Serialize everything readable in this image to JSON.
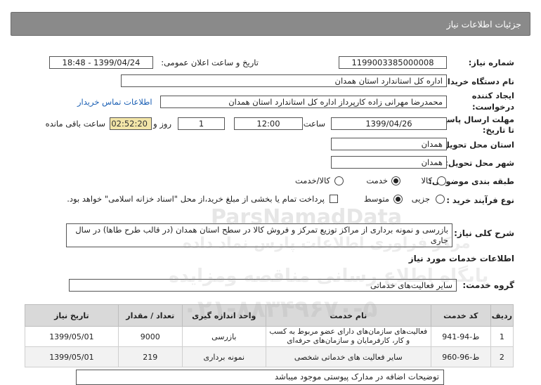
{
  "header": {
    "title": "جزئیات اطلاعات نیاز"
  },
  "labels": {
    "need_number": "شماره نیاز:",
    "announce_datetime": "تاریخ و ساعت اعلان عمومی:",
    "buyer_org": "نام دستگاه خریدار:",
    "creator_line1": "ایجاد کننده",
    "creator_line2": "درخواست:",
    "deadline_line1": "مهلت ارسال پاسخ:",
    "deadline_line2": "تا تاریخ:",
    "time": "ساعت",
    "day_and": "روز و",
    "remaining": "ساعت باقی مانده",
    "province": "استان محل تحویل:",
    "city": "شهر محل تحویل:",
    "category": "طبقه بندی موضوعی:",
    "process_type": "نوع فرآیند خرید :",
    "need_desc": "شرح کلی نیاز:",
    "services_info": "اطلاعات خدمات مورد نیاز",
    "service_group": "گروه خدمت:"
  },
  "values": {
    "need_number": "1199003385000008",
    "announce_datetime": "1399/04/24 - 18:48",
    "buyer_org": "اداره کل استاندارد استان همدان",
    "creator": "محمدرضا مهرانی زاده کارپرداز اداره کل استاندارد استان همدان",
    "contact_link": "اطلاعات تماس خریدار",
    "deadline_date": "1399/04/26",
    "deadline_time": "12:00",
    "days": "1",
    "remaining_time": "02:52:20",
    "province": "همدان",
    "city": "همدان",
    "need_desc": "بازرسی و نمونه برداری از مراکز توزیع  تمرکز و فروش کالا در سطح استان همدان (در قالب طرح طاها) در سال جاری",
    "service_group": "سایر فعالیت‌های خدماتی",
    "extra_note": "توضیحات اضافه در مدارک پیوستی موجود میباشد"
  },
  "category_options": {
    "goods": "کالا",
    "service": "خدمت",
    "goods_service": "کالا/خدمت",
    "selected": "service"
  },
  "process_options": {
    "partial": "جزیی",
    "medium": "متوسط",
    "selected": "medium",
    "treasury_note": "پرداخت تمام یا بخشی از مبلغ خرید،از محل \"اسناد خزانه اسلامی\" خواهد بود."
  },
  "table": {
    "headers": [
      "ردیف",
      "کد خدمت",
      "نام خدمت",
      "واحد اندازه گیری",
      "تعداد / مقدار",
      "تاریخ نیاز"
    ],
    "rows": [
      [
        "1",
        "ط-94-941",
        "فعالیت‌های سازمان‌های دارای عضو مربوط به کسب و کار، کارفرمایان و سازمان‌های حرفه‌ای",
        "بازرسی",
        "9000",
        "1399/05/01"
      ],
      [
        "2",
        "ط-96-960",
        "سایر فعالیت های خدماتی شخصی",
        "نمونه برداری",
        "219",
        "1399/05/01"
      ]
    ]
  },
  "watermark": {
    "brand": "ParsNamadData",
    "line1": "مرکز فراوری اطلاعات پارس نماد داده",
    "line2": "پایگاه اطلاع رسانی مناقصه ومزایده",
    "phone": "۰۲۱-۸۸۳۴۹۶۷۰-۵"
  },
  "colors": {
    "header_bg": "#8a8a8a",
    "remaining_bg": "#f3e6a8",
    "link": "#1a5fb4"
  }
}
